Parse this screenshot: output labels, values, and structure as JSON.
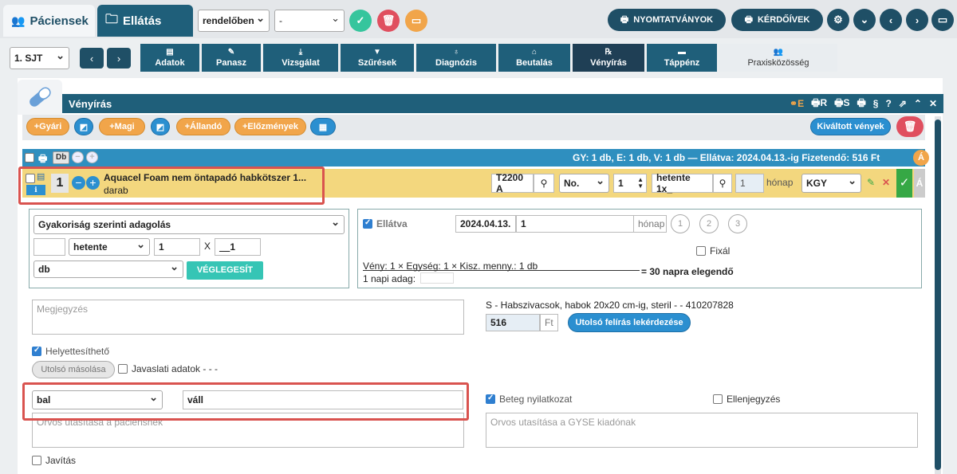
{
  "topbar": {
    "tab_patients": "Páciensek",
    "tab_care": "Ellátás",
    "select_office": "rendelőben",
    "select_dash": "-",
    "btn_forms": "NYOMTATVÁNYOK",
    "btn_questionnaires": "KÉRDŐÍVEK"
  },
  "nav": {
    "sjt_select": "1. SJT",
    "tabs": [
      "Adatok",
      "Panasz",
      "Vizsgálat",
      "Szűrések",
      "Diagnózis",
      "Beutalás",
      "Vényírás",
      "Táppénz",
      "Praxisközösség"
    ]
  },
  "panel": {
    "title": "Vényírás",
    "title_icons": [
      "E",
      "R",
      "S"
    ],
    "actions": {
      "gyari": "+Gyári",
      "magi": "+Magi",
      "allando": "+Állandó",
      "elozmenyek": "+Előzmények",
      "kivaltott": "Kiváltott vények"
    },
    "summary": {
      "left": "Db",
      "text": "GY: 1 db,  E: 1 db,  V: 1 db  —  Ellátva: 2024.04.13.-ig  Fizetendő: 516 Ft",
      "badge": "Á"
    },
    "item": {
      "qty": "1",
      "name": "Aquacel Foam nem öntapadó habkötszer 1...",
      "unit": "darab",
      "code": "T2200 A",
      "no_select": "No.",
      "count": "1",
      "freq": "hetente 1x_",
      "months": "1",
      "months_label": "hónap",
      "kgy_select": "KGY",
      "end_badge": "Á"
    },
    "dosage": {
      "mode_select": "Gyakoriság szerinti adagolás",
      "period_select": "hetente",
      "amount": "1",
      "x_label": "X",
      "times": "1",
      "unit_select": "db",
      "finalize": "VÉGLEGESÍT"
    },
    "supply": {
      "served_label": "Ellátva",
      "date": "2024.04.13.",
      "months": "1",
      "months_label": "hónap",
      "circles": [
        "1",
        "2",
        "3"
      ],
      "fix_label": "Fixál",
      "formula": "Vény: 1 × Egység: 1 × Kisz. menny.: 1 db",
      "result": "= 30 napra elegendő",
      "daily_label": "1 napi adag:"
    },
    "note_placeholder": "Megjegyzés",
    "product_desc": "S - Habszivacsok, habok 20x20 cm-ig, steril - - 410207828",
    "price": "516",
    "price_unit": "Ft",
    "last_query_btn": "Utolsó felírás lekérdezése",
    "substitutable": "Helyettesíthető",
    "last_copy": "Utolsó másolása",
    "proposal": "Javaslati adatok - - -",
    "side_select": "bal",
    "body_part": "váll",
    "patient_decl": "Beteg nyilatkozat",
    "countersign": "Ellenjegyzés",
    "doctor_patient_placeholder": "Orvos utasítása a páciensnek",
    "doctor_gyse_placeholder": "Orvos utasítása a GYSE kiadónak",
    "correction": "Javítás"
  },
  "colors": {
    "primary": "#1f5f7a",
    "orange": "#f1a54a",
    "blue": "#2b8fd0",
    "yellow_row": "#f3d77e",
    "highlight": "#d9534f"
  }
}
